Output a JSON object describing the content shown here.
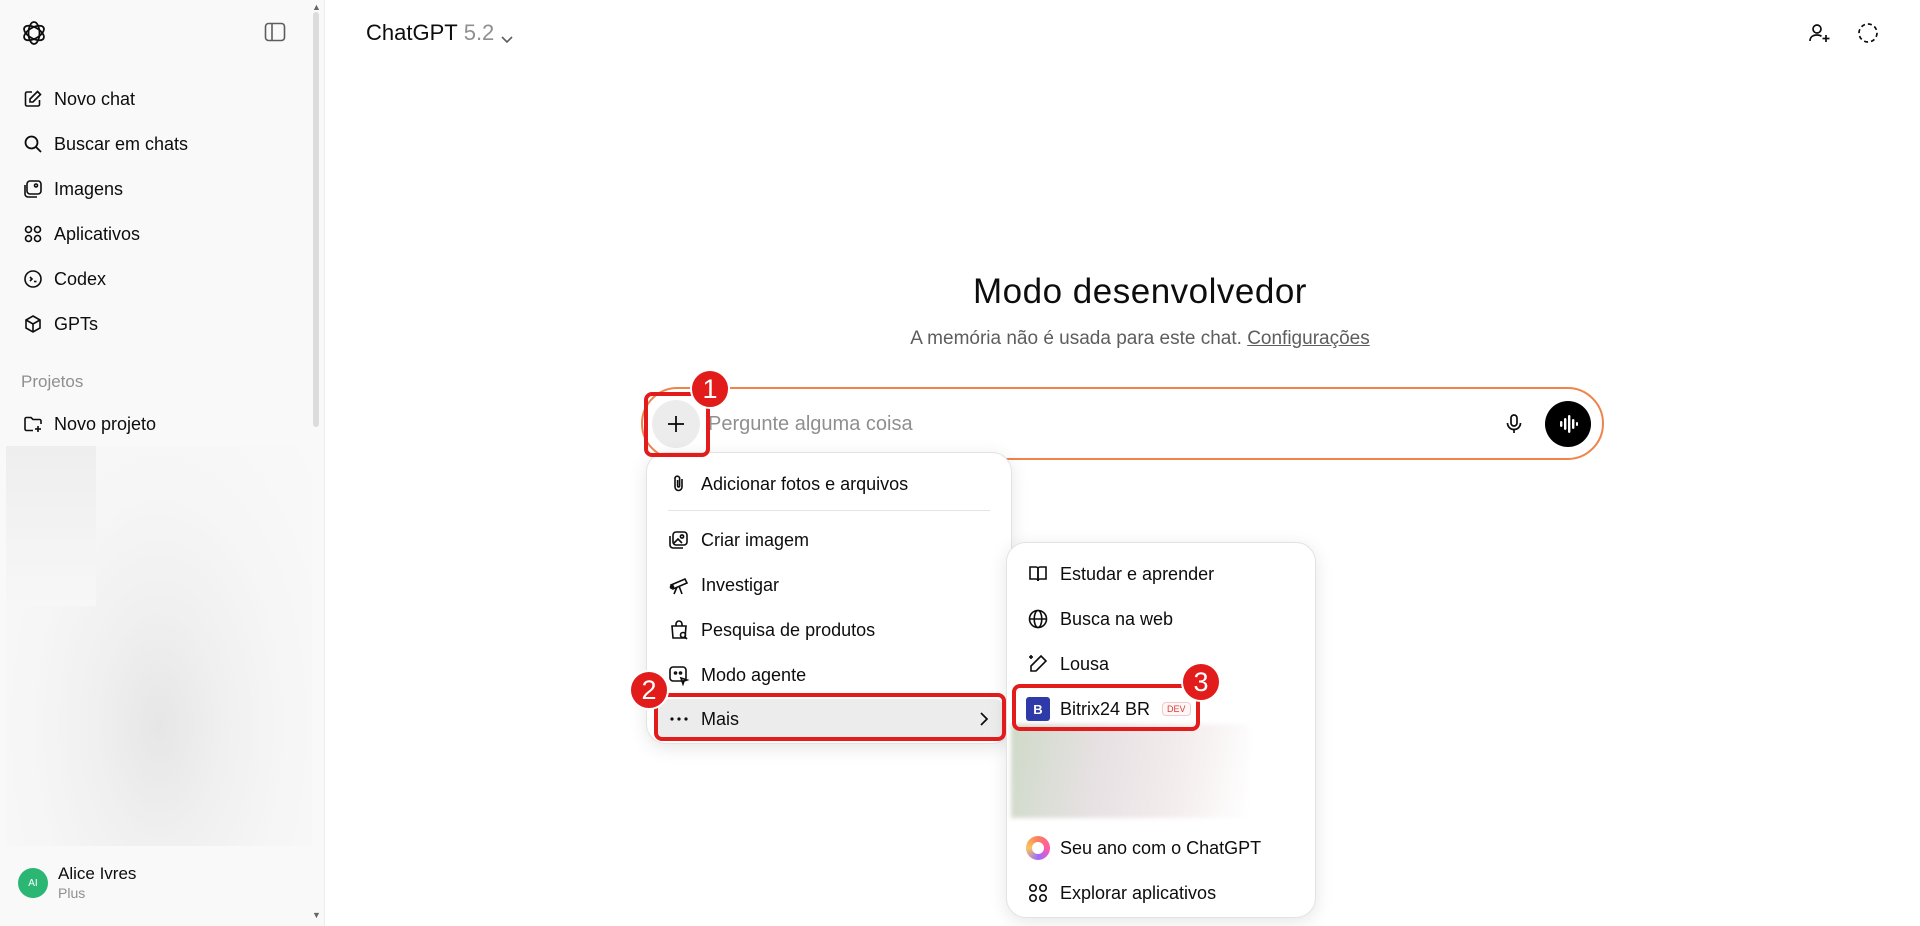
{
  "sidebar": {
    "items": [
      {
        "label": "Novo chat",
        "icon": "edit-icon"
      },
      {
        "label": "Buscar em chats",
        "icon": "search-icon"
      },
      {
        "label": "Imagens",
        "icon": "images-icon"
      },
      {
        "label": "Aplicativos",
        "icon": "apps-icon"
      },
      {
        "label": "Codex",
        "icon": "codex-icon"
      },
      {
        "label": "GPTs",
        "icon": "cube-icon"
      }
    ],
    "section_label": "Projetos",
    "new_project_label": "Novo projeto",
    "user": {
      "initials": "AI",
      "name": "Alice Ivres",
      "plan": "Plus"
    }
  },
  "header": {
    "model_name": "ChatGPT",
    "model_version": "5.2"
  },
  "main": {
    "title": "Modo desenvolvedor",
    "subtitle": "A memória não é usada para este chat.",
    "subtitle_link": "Configurações",
    "composer_placeholder": "Pergunte alguma coisa"
  },
  "attach_menu": {
    "items": [
      {
        "label": "Adicionar fotos e arquivos",
        "icon": "paperclip-icon"
      },
      {
        "label": "Criar imagem",
        "icon": "image-create-icon"
      },
      {
        "label": "Investigar",
        "icon": "telescope-icon"
      },
      {
        "label": "Pesquisa de produtos",
        "icon": "shopping-bag-icon"
      },
      {
        "label": "Modo agente",
        "icon": "agent-icon"
      },
      {
        "label": "Mais",
        "icon": "more-dots-icon"
      }
    ]
  },
  "more_menu": {
    "items": [
      {
        "label": "Estudar e aprender",
        "icon": "book-icon"
      },
      {
        "label": "Busca na web",
        "icon": "globe-icon"
      },
      {
        "label": "Lousa",
        "icon": "pen-icon"
      },
      {
        "label": "Bitrix24 BR",
        "icon": "bitrix-logo",
        "badge": "DEV",
        "logo_letter": "B"
      },
      {
        "label": "Seu ano com o ChatGPT",
        "icon": "year-icon"
      },
      {
        "label": "Explorar aplicativos",
        "icon": "apps-icon"
      }
    ]
  },
  "annotations": [
    "1",
    "2",
    "3"
  ],
  "colors": {
    "accent_border": "#f0834a",
    "highlight": "#e21b1b",
    "avatar": "#2bb673"
  }
}
